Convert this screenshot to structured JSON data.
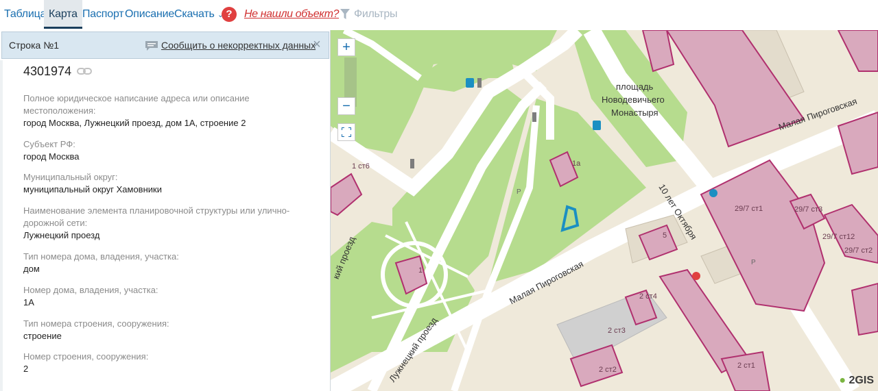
{
  "tabs": {
    "table": "Таблица",
    "map": "Карта",
    "passport": "Паспорт",
    "description": "Описание",
    "download": "Скачать",
    "help": "?",
    "not_found": "Не нашли объект?",
    "filters": "Фильтры"
  },
  "panel": {
    "row_label": "Строка №1",
    "report_link": "Сообщить о некорректных данных",
    "close": "×",
    "object_id": "4301974",
    "fields": [
      {
        "label": "Полное юридическое написание адреса или описание местоположения:",
        "value": "город Москва, Лужнецкий проезд, дом 1А, строение 2"
      },
      {
        "label": "Субъект РФ:",
        "value": "город Москва"
      },
      {
        "label": "Муниципальный округ:",
        "value": "муниципальный округ Хамовники"
      },
      {
        "label": "Наименование элемента планировочной структуры или улично-дорожной сети:",
        "value": "Лужнецкий проезд"
      },
      {
        "label": "Тип номера дома, владения, участка:",
        "value": "дом"
      },
      {
        "label": "Номер дома, владения, участка:",
        "value": "1А"
      },
      {
        "label": "Тип номера строения, сооружения:",
        "value": "строение"
      },
      {
        "label": "Номер строения, сооружения:",
        "value": "2"
      }
    ]
  },
  "map": {
    "zoom_in": "+",
    "zoom_out": "−",
    "labels": {
      "square_line1": "площадь",
      "square_line2": "Новодевичьего",
      "square_line3": "Монастыря",
      "malaya_pirogovskaya_top": "Малая Пироговская",
      "malaya_pirogovskaya_bottom": "Малая Пироговская",
      "ten_let_oktyabrya": "10 лет Октября",
      "luzhnetsky_left": "кий проезд",
      "luzhnetsky_bottom": "Лужнецкий проезд",
      "parking1": "P",
      "parking2": "P"
    },
    "buildings": {
      "b1st6": "1 ст6",
      "b1a": "1а",
      "b1": "1",
      "b5": "5",
      "b29_7st1": "29/7 ст1",
      "b29_7st3": "29/7 ст3",
      "b29_7st12": "29/7 ст12",
      "b29_7st2": "29/7 ст2",
      "b2st4": "2 ст4",
      "b2st3": "2 ст3",
      "b2st2": "2 ст2",
      "b2st1": "2 ст1"
    },
    "logo": "2GIS"
  },
  "colors": {
    "link": "#1a6fb0",
    "alert": "#d03030",
    "park": "#b6dc8e",
    "building_hl": "#d9a9bd",
    "building_border": "#b0306e",
    "road": "#ffffff"
  }
}
